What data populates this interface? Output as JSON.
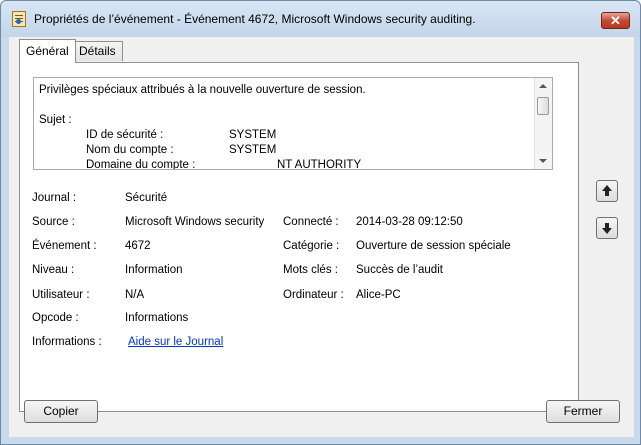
{
  "window": {
    "title": "Propriétés de l’événement - Événement 4672, Microsoft Windows security auditing.",
    "close_glyph": "✕"
  },
  "tabs": [
    {
      "label": "Général",
      "active": true
    },
    {
      "label": "Détails",
      "active": false
    }
  ],
  "description": {
    "line1": "Privilèges spéciaux attribués à la nouvelle ouverture de session.",
    "subject_label": "Sujet :",
    "rows": [
      {
        "label": "ID de sécurité :",
        "value": "SYSTEM"
      },
      {
        "label": "Nom du compte :",
        "value": "SYSTEM"
      },
      {
        "label": "Domaine du compte :",
        "value": "NT AUTHORITY"
      }
    ]
  },
  "fields": {
    "journal": {
      "label": "Journal :",
      "value": "Sécurité"
    },
    "source": {
      "label": "Source :",
      "value": "Microsoft Windows security"
    },
    "connecte": {
      "label": "Connecté :",
      "value": "2014-03-28 09:12:50"
    },
    "evenement": {
      "label": "Événement :",
      "value": "4672"
    },
    "categorie": {
      "label": "Catégorie :",
      "value": "Ouverture de session spéciale"
    },
    "niveau": {
      "label": "Niveau :",
      "value": "Information"
    },
    "mots_cles": {
      "label": "Mots clés :",
      "value": "Succès de l’audit"
    },
    "utilisateur": {
      "label": "Utilisateur :",
      "value": "N/A"
    },
    "ordinateur": {
      "label": "Ordinateur :",
      "value": "Alice-PC"
    },
    "opcode": {
      "label": "Opcode :",
      "value": "Informations"
    },
    "informations": {
      "label": "Informations :",
      "value": "Aide sur le Journal"
    }
  },
  "buttons": {
    "copy": "Copier",
    "close": "Fermer"
  },
  "icons": [
    "event-viewer-icon",
    "close-icon",
    "scroll-up-arrow-icon",
    "scroll-down-arrow-icon",
    "previous-event-arrow-icon",
    "next-event-arrow-icon"
  ]
}
